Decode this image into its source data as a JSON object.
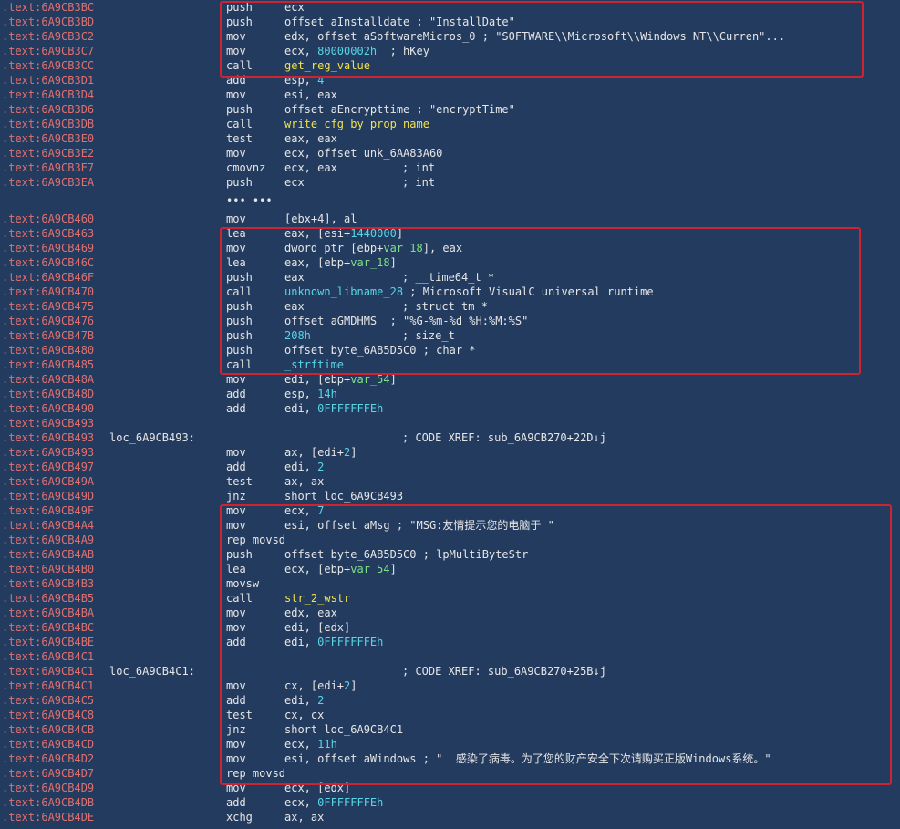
{
  "colors": {
    "background": "#233b5e",
    "address": "#e07070",
    "text": "#e6e6e6",
    "function_name": "#f2e24a",
    "library_name": "#57d6e6",
    "var_local": "#7fe08a",
    "highlight_box": "#d1232f"
  },
  "lines": [
    {
      "addr": ".text:6A9CB3BC",
      "mnem": "push",
      "ops": "ecx"
    },
    {
      "addr": ".text:6A9CB3BD",
      "mnem": "push",
      "ops": "offset aInstalldate ; \"InstallDate\""
    },
    {
      "addr": ".text:6A9CB3C2",
      "mnem": "mov",
      "ops": "edx, offset aSoftwareMicros_0 ; \"SOFTWARE\\\\Microsoft\\\\Windows NT\\\\Curren\"..."
    },
    {
      "addr": ".text:6A9CB3C7",
      "mnem": "mov",
      "ops_pre": "ecx, ",
      "ops_num": "80000002h",
      "ops_post": "  ; hKey"
    },
    {
      "addr": ".text:6A9CB3CC",
      "mnem": "call",
      "ops_fn": "get_reg_value",
      "fn_color": "y"
    },
    {
      "addr": ".text:6A9CB3D1",
      "mnem": "add",
      "ops_pre": "esp, ",
      "ops_num": "4"
    },
    {
      "addr": ".text:6A9CB3D4",
      "mnem": "mov",
      "ops": "esi, eax"
    },
    {
      "addr": ".text:6A9CB3D6",
      "mnem": "push",
      "ops": "offset aEncrypttime ; \"encryptTime\""
    },
    {
      "addr": ".text:6A9CB3DB",
      "mnem": "call",
      "ops_fn": "write_cfg_by_prop_name",
      "fn_color": "y"
    },
    {
      "addr": ".text:6A9CB3E0",
      "mnem": "test",
      "ops": "eax, eax"
    },
    {
      "addr": ".text:6A9CB3E2",
      "mnem": "mov",
      "ops": "ecx, offset unk_6AA83A60"
    },
    {
      "addr": ".text:6A9CB3E7",
      "mnem": "cmovnz",
      "ops": "ecx, eax",
      "cmt": "; int"
    },
    {
      "addr": ".text:6A9CB3EA",
      "mnem": "push",
      "ops": "ecx",
      "cmt": "; int"
    },
    {
      "ellipsis": "••• •••"
    },
    {
      "addr": ".text:6A9CB460",
      "mnem": "mov",
      "ops": "[ebx+4], al"
    },
    {
      "addr": ".text:6A9CB463",
      "mnem": "lea",
      "ops_pre": "eax, [esi+",
      "ops_num": "1440000",
      "ops_post": "]"
    },
    {
      "addr": ".text:6A9CB469",
      "mnem": "mov",
      "ops_pre": "dword ptr [ebp+",
      "ops_var": "var_18",
      "ops_post": "], eax"
    },
    {
      "addr": ".text:6A9CB46C",
      "mnem": "lea",
      "ops_pre": "eax, [ebp+",
      "ops_var": "var_18",
      "ops_post": "]"
    },
    {
      "addr": ".text:6A9CB46F",
      "mnem": "push",
      "ops": "eax",
      "cmt": "; __time64_t *"
    },
    {
      "addr": ".text:6A9CB470",
      "mnem": "call",
      "ops_fn": "unknown_libname_28",
      "fn_color": "c",
      "ops_post": " ; Microsoft VisualC universal runtime"
    },
    {
      "addr": ".text:6A9CB475",
      "mnem": "push",
      "ops": "eax",
      "cmt": "; struct tm *"
    },
    {
      "addr": ".text:6A9CB476",
      "mnem": "push",
      "ops": "offset aGMDHMS  ; \"%G-%m-%d %H:%M:%S\""
    },
    {
      "addr": ".text:6A9CB47B",
      "mnem": "push",
      "ops_num": "208h",
      "cmt": "; size_t"
    },
    {
      "addr": ".text:6A9CB480",
      "mnem": "push",
      "ops": "offset byte_6AB5D5C0 ; char *"
    },
    {
      "addr": ".text:6A9CB485",
      "mnem": "call",
      "ops_fn": "_strftime",
      "fn_color": "c"
    },
    {
      "addr": ".text:6A9CB48A",
      "mnem": "mov",
      "ops_pre": "edi, [ebp+",
      "ops_var": "var_54",
      "ops_post": "]"
    },
    {
      "addr": ".text:6A9CB48D",
      "mnem": "add",
      "ops_pre": "esp, ",
      "ops_num": "14h"
    },
    {
      "addr": ".text:6A9CB490",
      "mnem": "add",
      "ops_pre": "edi, ",
      "ops_num": "0FFFFFFFEh"
    },
    {
      "addr": ".text:6A9CB493"
    },
    {
      "addr": ".text:6A9CB493",
      "label": "loc_6A9CB493:",
      "cmt": "; CODE XREF: sub_6A9CB270+22D↓j"
    },
    {
      "addr": ".text:6A9CB493",
      "mnem": "mov",
      "ops_pre": "ax, [edi+",
      "ops_num": "2",
      "ops_post": "]"
    },
    {
      "addr": ".text:6A9CB497",
      "mnem": "add",
      "ops_pre": "edi, ",
      "ops_num": "2"
    },
    {
      "addr": ".text:6A9CB49A",
      "mnem": "test",
      "ops": "ax, ax"
    },
    {
      "addr": ".text:6A9CB49D",
      "mnem": "jnz",
      "ops": "short loc_6A9CB493"
    },
    {
      "addr": ".text:6A9CB49F",
      "mnem": "mov",
      "ops_pre": "ecx, ",
      "ops_num": "7"
    },
    {
      "addr": ".text:6A9CB4A4",
      "mnem": "mov",
      "ops": "esi, offset aMsg ; \"MSG:友情提示您的电脑于 \""
    },
    {
      "addr": ".text:6A9CB4A9",
      "mnem": "rep movsd"
    },
    {
      "addr": ".text:6A9CB4AB",
      "mnem": "push",
      "ops": "offset byte_6AB5D5C0 ; lpMultiByteStr"
    },
    {
      "addr": ".text:6A9CB4B0",
      "mnem": "lea",
      "ops_pre": "ecx, [ebp+",
      "ops_var": "var_54",
      "ops_post": "]"
    },
    {
      "addr": ".text:6A9CB4B3",
      "mnem": "movsw"
    },
    {
      "addr": ".text:6A9CB4B5",
      "mnem": "call",
      "ops_fn": "str_2_wstr",
      "fn_color": "y"
    },
    {
      "addr": ".text:6A9CB4BA",
      "mnem": "mov",
      "ops": "edx, eax"
    },
    {
      "addr": ".text:6A9CB4BC",
      "mnem": "mov",
      "ops": "edi, [edx]"
    },
    {
      "addr": ".text:6A9CB4BE",
      "mnem": "add",
      "ops_pre": "edi, ",
      "ops_num": "0FFFFFFFEh"
    },
    {
      "addr": ".text:6A9CB4C1"
    },
    {
      "addr": ".text:6A9CB4C1",
      "label": "loc_6A9CB4C1:",
      "cmt": "; CODE XREF: sub_6A9CB270+25B↓j"
    },
    {
      "addr": ".text:6A9CB4C1",
      "mnem": "mov",
      "ops_pre": "cx, [edi+",
      "ops_num": "2",
      "ops_post": "]"
    },
    {
      "addr": ".text:6A9CB4C5",
      "mnem": "add",
      "ops_pre": "edi, ",
      "ops_num": "2"
    },
    {
      "addr": ".text:6A9CB4C8",
      "mnem": "test",
      "ops": "cx, cx"
    },
    {
      "addr": ".text:6A9CB4CB",
      "mnem": "jnz",
      "ops": "short loc_6A9CB4C1"
    },
    {
      "addr": ".text:6A9CB4CD",
      "mnem": "mov",
      "ops_pre": "ecx, ",
      "ops_num": "11h"
    },
    {
      "addr": ".text:6A9CB4D2",
      "mnem": "mov",
      "ops": "esi, offset aWindows ; \"  感染了病毒。为了您的财产安全下次请购买正版Windows系统。\""
    },
    {
      "addr": ".text:6A9CB4D7",
      "mnem": "rep movsd"
    },
    {
      "addr": ".text:6A9CB4D9",
      "mnem": "mov",
      "ops": "ecx, [edx]"
    },
    {
      "addr": ".text:6A9CB4DB",
      "mnem": "add",
      "ops_pre": "ecx, ",
      "ops_num": "0FFFFFFFEh"
    },
    {
      "addr": ".text:6A9CB4DE",
      "mnem": "xchg",
      "ops": "ax, ax"
    }
  ]
}
